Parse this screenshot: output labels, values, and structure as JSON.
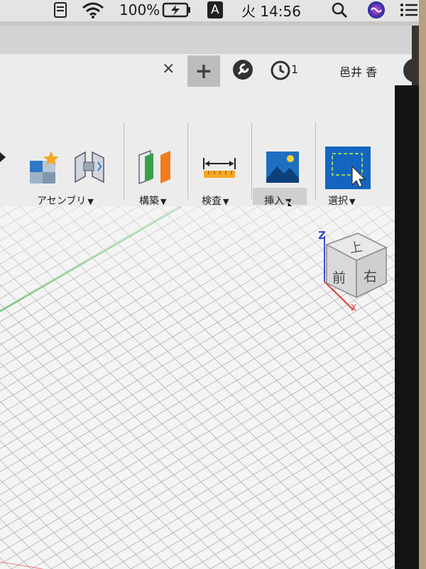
{
  "menubar": {
    "battery": "100%",
    "input_source": "A",
    "clock": "火 14:56"
  },
  "tabbar": {
    "close_symbol": "×",
    "add_symbol": "+",
    "jobs_count": "1",
    "user_name": "邑井 香",
    "help_symbol": "?"
  },
  "toolbar": {
    "assemble_label": "アセンブリ",
    "construct_label": "構築",
    "inspect_label": "検査",
    "insert_label": "挿入",
    "select_label": "選択",
    "dropdown_arrow": "▼"
  },
  "viewcube": {
    "top_face": "上",
    "front_face": "前",
    "right_face": "右",
    "axis_z": "Z",
    "axis_x": "X"
  },
  "colors": {
    "accent_blue": "#1565c0",
    "green_axis": "#4caf50",
    "red_axis": "#e53935"
  }
}
